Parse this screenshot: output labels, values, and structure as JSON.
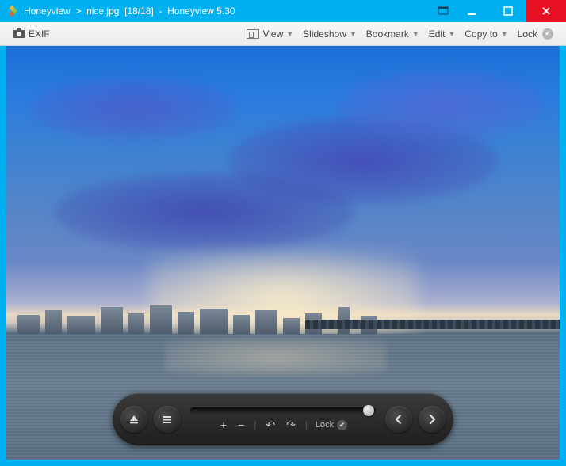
{
  "titlebar": {
    "app_name": "Honeyview",
    "separator": ">",
    "filename": "nice.jpg",
    "counter": "[18/18]",
    "dash": "-",
    "version": "Honeyview 5.30"
  },
  "toolbar": {
    "exif": "EXIF",
    "view": "View",
    "slideshow": "Slideshow",
    "bookmark": "Bookmark",
    "edit": "Edit",
    "copyto": "Copy to",
    "lock": "Lock"
  },
  "player": {
    "lock": "Lock",
    "zoom_in": "+",
    "zoom_out": "−",
    "undo": "↶",
    "redo": "↷"
  }
}
